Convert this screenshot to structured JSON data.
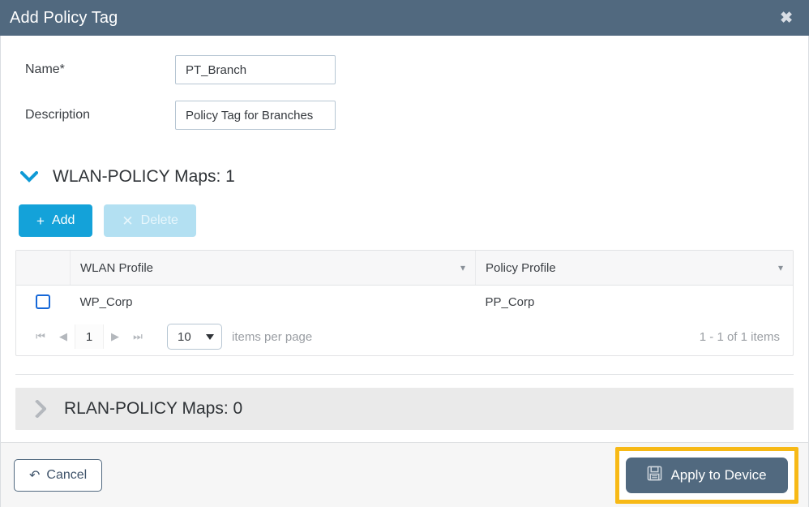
{
  "dialog": {
    "title": "Add Policy Tag",
    "close_icon": "close-icon"
  },
  "form": {
    "name": {
      "label": "Name*",
      "value": "PT_Branch",
      "placeholder": ""
    },
    "description": {
      "label": "Description",
      "value": "Policy Tag for Branches",
      "placeholder": ""
    }
  },
  "wlan_section": {
    "title": "WLAN-POLICY Maps: 1",
    "expanded": true,
    "chevron_icon": "chevron-down-icon",
    "add_button": {
      "label": "Add",
      "icon": "plus-icon"
    },
    "delete_button": {
      "label": "Delete",
      "icon": "close-x-icon",
      "disabled": true
    },
    "table": {
      "columns": [
        "WLAN Profile",
        "Policy Profile"
      ],
      "rows": [
        {
          "wlan_profile": "WP_Corp",
          "policy_profile": "PP_Corp",
          "selected": false
        }
      ]
    },
    "pagination": {
      "first_icon": "first-page-icon",
      "prev_icon": "prev-page-icon",
      "page": "1",
      "next_icon": "next-page-icon",
      "last_icon": "last-page-icon",
      "items_per_page": "10",
      "items_per_page_label": "items per page",
      "count_label": "1 - 1 of 1 items"
    }
  },
  "rlan_section": {
    "title": "RLAN-POLICY Maps: 0",
    "expanded": false,
    "chevron_icon": "chevron-right-icon"
  },
  "footer": {
    "cancel": {
      "label": "Cancel",
      "icon": "undo-icon"
    },
    "apply": {
      "label": "Apply to Device",
      "icon": "save-icon"
    }
  },
  "colors": {
    "header_bar": "#51697f",
    "add_button": "#14a2d9",
    "delete_button": "#b3e0f2",
    "highlight": "#f7b916",
    "apply_button": "#51697f",
    "checkbox_border": "#1668d8"
  }
}
